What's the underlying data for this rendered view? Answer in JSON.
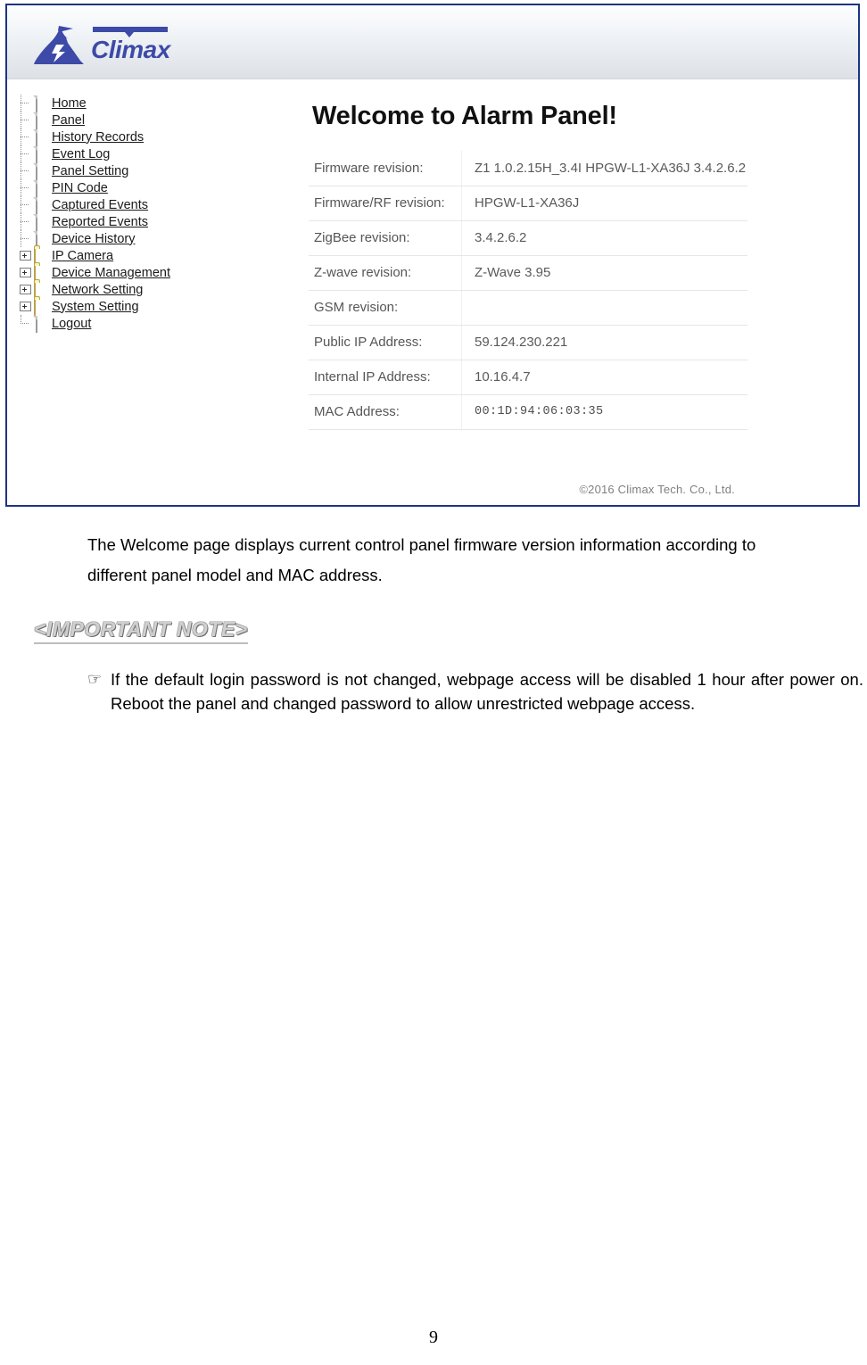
{
  "screenshot": {
    "logo": {
      "wordmark": "Climax",
      "icon": "mountain-lightning-logo"
    },
    "nav_tree": {
      "items": [
        {
          "label": "Home",
          "icon": "document-icon",
          "expandable": false
        },
        {
          "label": "Panel",
          "icon": "document-icon",
          "expandable": false
        },
        {
          "label": "History Records",
          "icon": "document-icon",
          "expandable": false
        },
        {
          "label": "Event Log",
          "icon": "document-icon",
          "expandable": false
        },
        {
          "label": "Panel Setting",
          "icon": "document-icon",
          "expandable": false
        },
        {
          "label": "PIN Code",
          "icon": "document-icon",
          "expandable": false
        },
        {
          "label": "Captured Events",
          "icon": "document-icon",
          "expandable": false
        },
        {
          "label": "Reported Events",
          "icon": "document-icon",
          "expandable": false
        },
        {
          "label": "Device History",
          "icon": "document-icon",
          "expandable": false
        },
        {
          "label": "IP Camera",
          "icon": "folder-icon",
          "expandable": true
        },
        {
          "label": "Device Management",
          "icon": "folder-icon",
          "expandable": true
        },
        {
          "label": "Network Setting",
          "icon": "folder-icon",
          "expandable": true
        },
        {
          "label": "System Setting",
          "icon": "folder-icon",
          "expandable": true
        },
        {
          "label": "Logout",
          "icon": "document-icon",
          "expandable": false
        }
      ]
    },
    "main": {
      "title": "Welcome to Alarm Panel!",
      "info_rows": [
        {
          "key": "Firmware revision:",
          "value": "Z1 1.0.2.15H_3.4I HPGW-L1-XA36J 3.4.2.6.2",
          "mono": false
        },
        {
          "key": "Firmware/RF revision:",
          "value": "HPGW-L1-XA36J",
          "mono": false
        },
        {
          "key": "ZigBee revision:",
          "value": "3.4.2.6.2",
          "mono": false
        },
        {
          "key": "Z-wave revision:",
          "value": "Z-Wave 3.95",
          "mono": false
        },
        {
          "key": "GSM revision:",
          "value": "",
          "mono": false
        },
        {
          "key": "Public IP Address:",
          "value": "59.124.230.221",
          "mono": false
        },
        {
          "key": "Internal IP Address:",
          "value": "10.16.4.7",
          "mono": false
        },
        {
          "key": "MAC Address:",
          "value": "00:1D:94:06:03:35",
          "mono": true
        }
      ]
    },
    "footer": "©2016 Climax Tech. Co., Ltd."
  },
  "document": {
    "paragraph": "The Welcome page displays current control panel firmware version information according to different panel model and MAC address.",
    "note_heading": "<IMPORTANT NOTE>",
    "bullet_glyph": "☞",
    "bullet_text": "If the default login password is not changed, webpage access will be disabled 1 hour after power on. Reboot the panel and changed password to allow unrestricted webpage access.",
    "page_number": "9"
  },
  "colors": {
    "panel_border": "#1c3581",
    "logo_blue": "#3d4aa8",
    "folder_yellow": "#fdf4bd",
    "table_rule": "#e6e6e6"
  }
}
